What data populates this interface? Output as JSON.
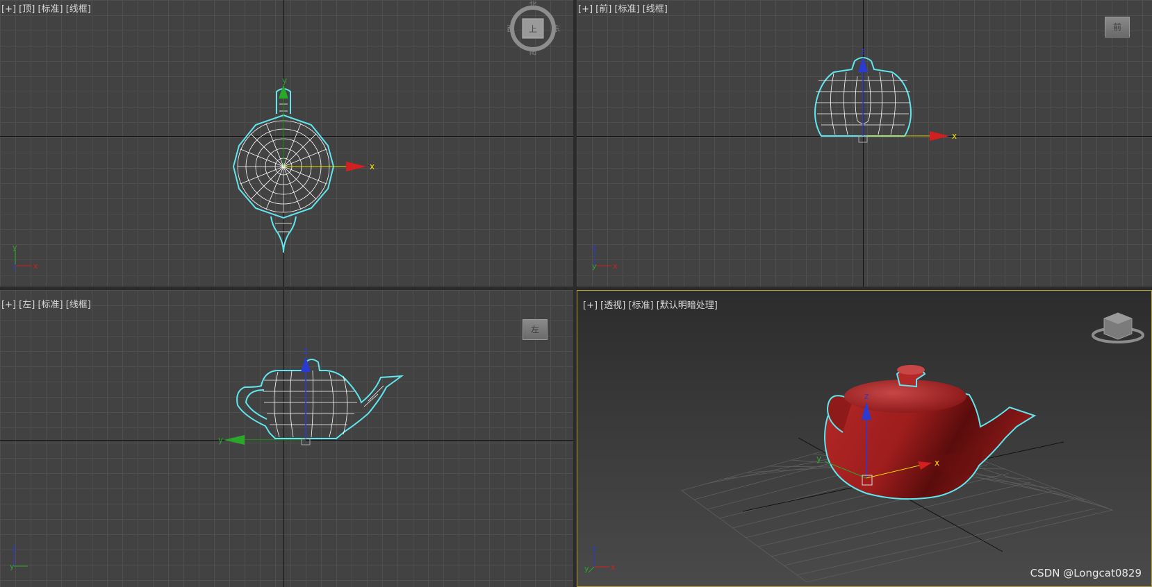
{
  "viewports": {
    "top": {
      "label": "[+] [顶] [标准] [线框]"
    },
    "front": {
      "label": "[+] [前] [标准] [线框]"
    },
    "left": {
      "label": "[+] [左] [标准] [线框]"
    },
    "perspective": {
      "label": "[+] [透视] [标准] [默认明暗处理]"
    }
  },
  "viewcube": {
    "top": {
      "face": "上",
      "north": "北",
      "south": "南",
      "east": "东",
      "west": "西"
    },
    "front": {
      "face": "前"
    },
    "left": {
      "face": "左"
    }
  },
  "axes": {
    "x": "x",
    "y": "y",
    "z": "z"
  },
  "watermark": "CSDN @Longcat0829",
  "colors": {
    "grid_bg": "#424242",
    "selection_outline": "#5fe6ee",
    "teapot_shaded": "#9e1d1d",
    "active_viewport_border": "#b9a33a",
    "x_axis": "#d31f1f",
    "y_axis": "#2aa82a",
    "z_axis": "#2a3ad3"
  }
}
